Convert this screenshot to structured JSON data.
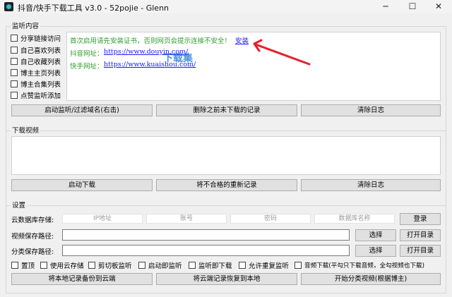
{
  "window": {
    "title": "抖音/快手下载工具 v3.0 - 52pojie - Glenn",
    "minimize_icon": "minimize-icon",
    "maximize_icon": "maximize-icon",
    "close_icon": "close-icon",
    "minimize_glyph": "─",
    "maximize_glyph": "☐",
    "close_glyph": "✕"
  },
  "monitor": {
    "group_title": "监听内容",
    "checkboxes": [
      {
        "label": "分享链接访问",
        "checked": false
      },
      {
        "label": "自己喜欢列表",
        "checked": false
      },
      {
        "label": "自己收藏列表",
        "checked": false
      },
      {
        "label": "博主主页列表",
        "checked": false
      },
      {
        "label": "博主合集列表",
        "checked": false
      },
      {
        "label": "点赞监听添加",
        "checked": false
      }
    ],
    "log": {
      "warning": "首次启用请先安装证书，否则网页会提示连接不安全！",
      "install_link": "安装",
      "douyin_label": "抖音网址：",
      "douyin_url": "https://www.douyin.com/",
      "kuaishou_label": "快手网址：",
      "kuaishou_url": "https://www.kuaishou.com/"
    },
    "watermark_text": "下载集",
    "buttons": {
      "start": "启动监听/过滤域名(右击)",
      "delete_records": "删除之前未下载的记录",
      "clear_log": "清除日志"
    }
  },
  "download": {
    "group_title": "下载视频",
    "buttons": {
      "start": "启动下载",
      "redo": "将不合格的重新记录",
      "clear_log": "清除日志"
    }
  },
  "settings": {
    "group_title": "设置",
    "cloud_db_label": "云数据库存储:",
    "ip_placeholder": "IP地址",
    "account_placeholder": "账号",
    "password_placeholder": "密码",
    "dbname_placeholder": "数据库名称",
    "login_button": "登录",
    "video_path_label": "视频保存路径:",
    "video_path_value": "",
    "category_path_label": "分类保存路径:",
    "category_path_value": "",
    "choose_button": "选择",
    "open_dir_button": "打开目录",
    "options": [
      {
        "label": "置顶",
        "checked": false
      },
      {
        "label": "使用云存储",
        "checked": false
      },
      {
        "label": "剪切板监听",
        "checked": false
      },
      {
        "label": "启动即监听",
        "checked": false
      },
      {
        "label": "监听即下载",
        "checked": false
      },
      {
        "label": "允许重复监听",
        "checked": false
      },
      {
        "label": "音频下载(平勾只下载音频，全勾视频也下载)",
        "checked": false
      }
    ],
    "buttons": {
      "backup": "将本地记录备份到云端",
      "restore": "将云端记录恢复到本地",
      "classify": "开始分类视频(根据博主)"
    }
  },
  "colors": {
    "warning_text": "#2e9d2e",
    "arrow": "#e5202a",
    "link": "#1a1aff"
  }
}
